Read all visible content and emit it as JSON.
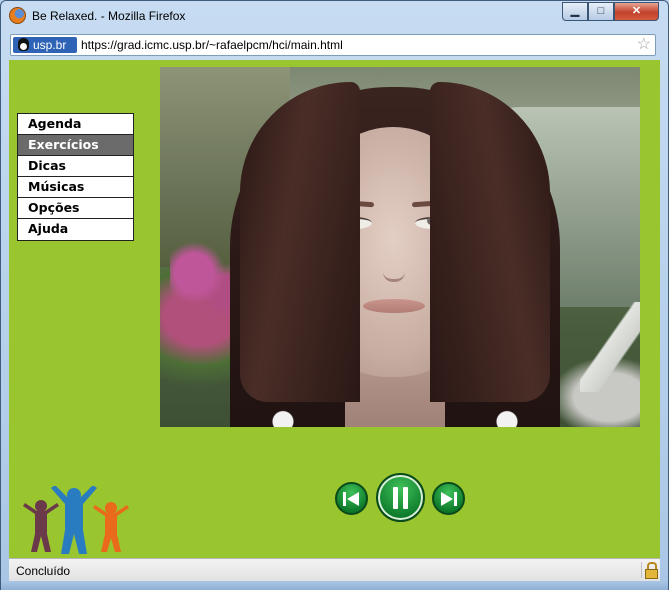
{
  "window": {
    "title": "Be Relaxed. - Mozilla Firefox",
    "buttons": {
      "minimize": "▁",
      "maximize": "□",
      "close": "✕"
    }
  },
  "addressbar": {
    "site_label": "usp.br",
    "url": "https://grad.icmc.usp.br/~rafaelpcm/hci/main.html",
    "bookmark_icon": "star-icon"
  },
  "menu": {
    "items": [
      {
        "label": "Agenda",
        "active": false
      },
      {
        "label": "Exercícios",
        "active": true
      },
      {
        "label": "Dicas",
        "active": false
      },
      {
        "label": "Músicas",
        "active": false
      },
      {
        "label": "Opções",
        "active": false
      },
      {
        "label": "Ajuda",
        "active": false
      }
    ]
  },
  "player": {
    "controls": [
      "previous-icon",
      "pause-icon",
      "next-icon"
    ]
  },
  "colors": {
    "page_background": "#99c52e",
    "menu_active": "#6b6b6b",
    "control_green": "#0f7d2c",
    "logo_figures": [
      "#6b3a4a",
      "#2a7cc0",
      "#e86a1a"
    ]
  },
  "statusbar": {
    "text": "Concluído",
    "lock_icon": "lock-icon"
  }
}
